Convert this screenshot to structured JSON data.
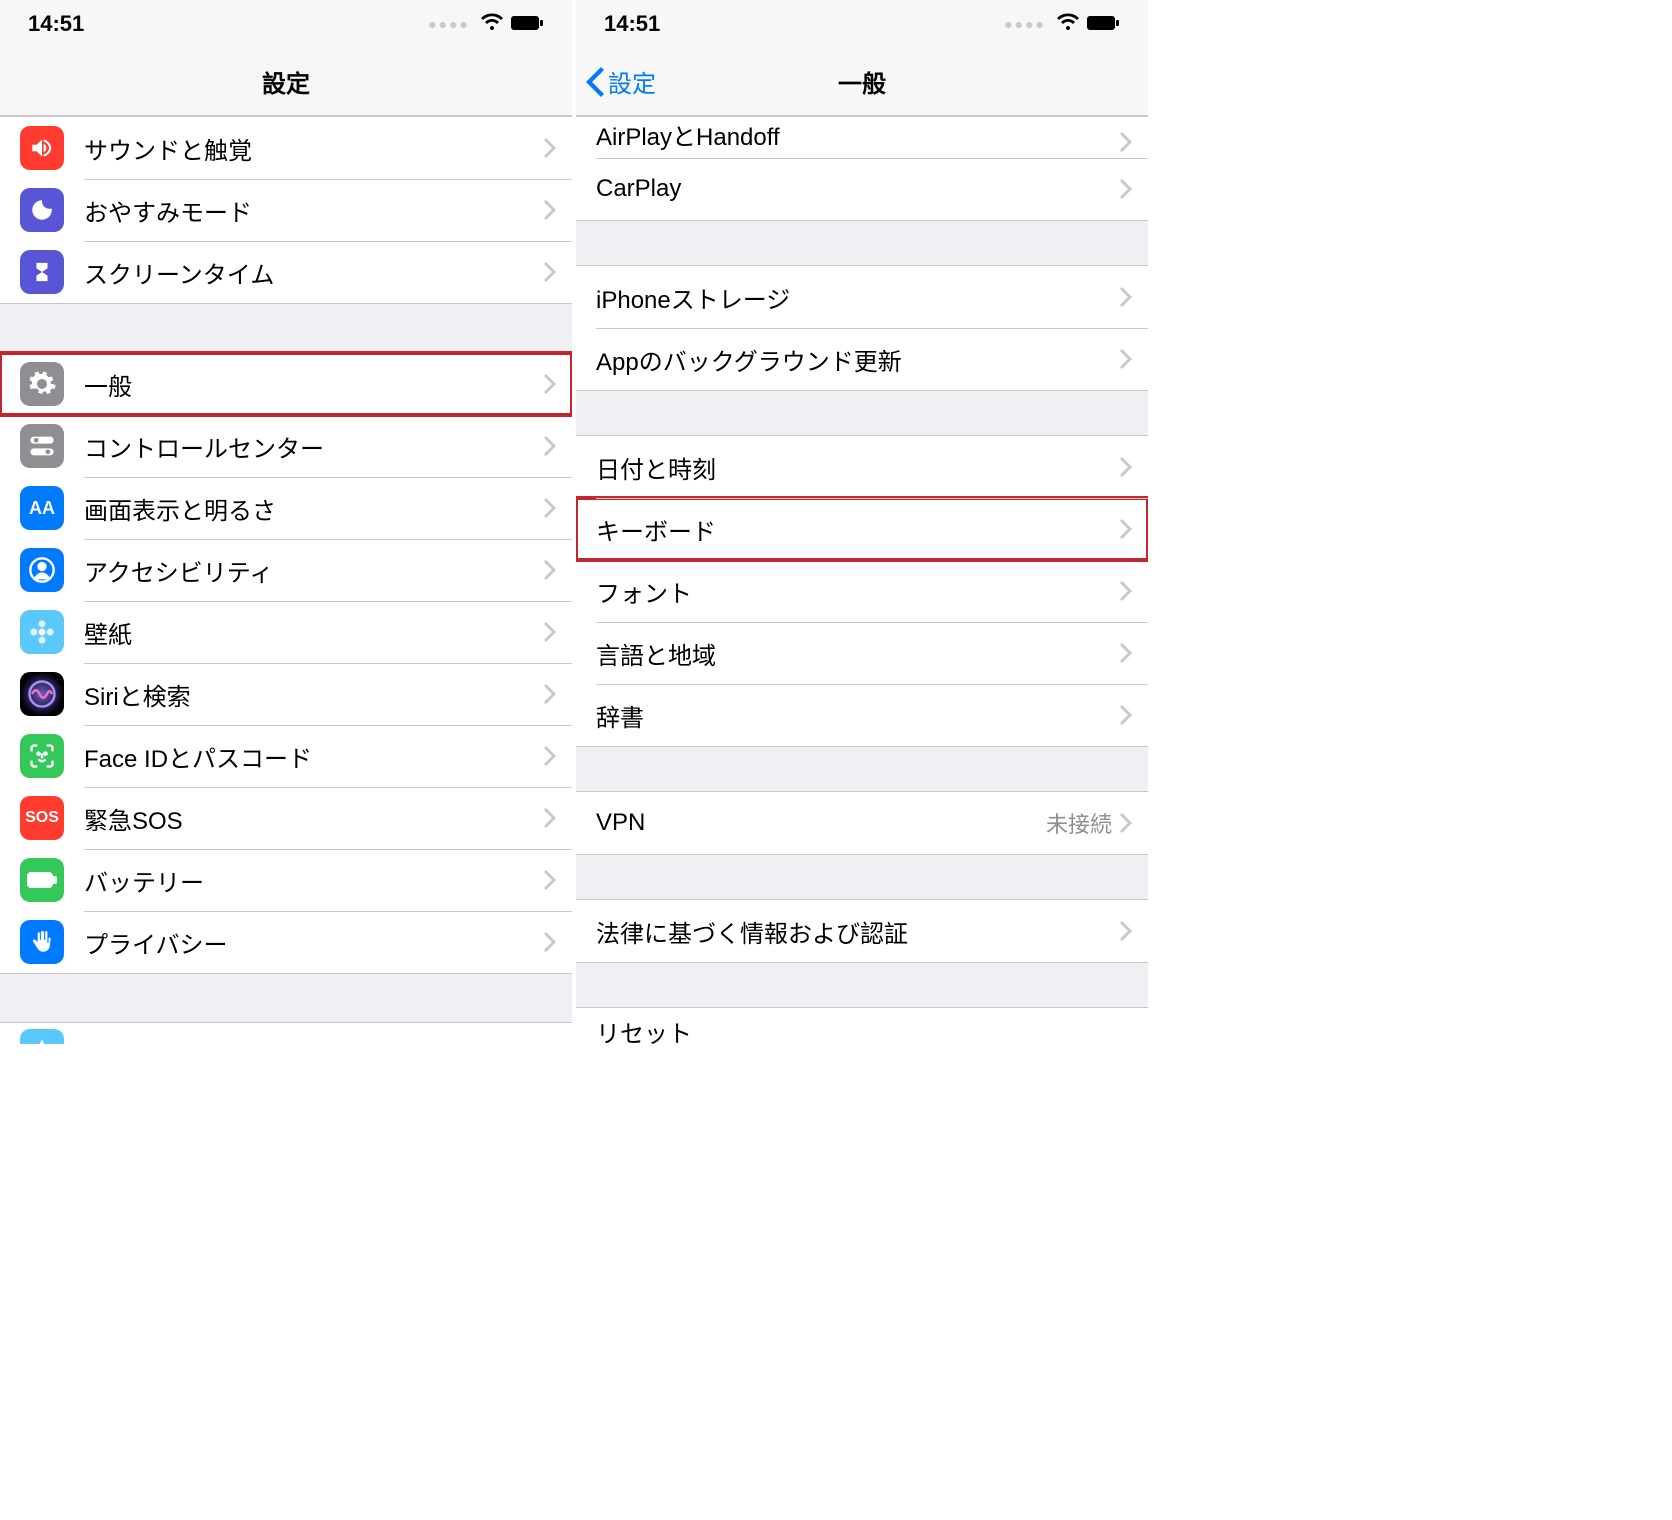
{
  "status": {
    "time": "14:51"
  },
  "left": {
    "title": "設定",
    "groups": [
      {
        "rows": [
          {
            "name": "sounds",
            "label": "サウンドと触覚",
            "icon": "speaker-icon",
            "bg": "bg-red"
          },
          {
            "name": "dnd",
            "label": "おやすみモード",
            "icon": "moon-icon",
            "bg": "bg-purple"
          },
          {
            "name": "screentime",
            "label": "スクリーンタイム",
            "icon": "hourglass-icon",
            "bg": "bg-purple2"
          }
        ]
      },
      {
        "rows": [
          {
            "name": "general",
            "label": "一般",
            "icon": "gear-icon",
            "bg": "bg-gray",
            "highlight": true
          },
          {
            "name": "control-center",
            "label": "コントロールセンター",
            "icon": "toggles-icon",
            "bg": "bg-gray2"
          },
          {
            "name": "display",
            "label": "画面表示と明るさ",
            "icon": "aa-icon",
            "bg": "bg-blue"
          },
          {
            "name": "accessibility",
            "label": "アクセシビリティ",
            "icon": "person-icon",
            "bg": "bg-blue"
          },
          {
            "name": "wallpaper",
            "label": "壁紙",
            "icon": "flower-icon",
            "bg": "bg-cyan"
          },
          {
            "name": "siri",
            "label": "Siriと検索",
            "icon": "siri-icon",
            "bg": "bg-siri"
          },
          {
            "name": "faceid",
            "label": "Face IDとパスコード",
            "icon": "faceid-icon",
            "bg": "bg-green"
          },
          {
            "name": "sos",
            "label": "緊急SOS",
            "icon": "sos-icon",
            "bg": "bg-sos"
          },
          {
            "name": "battery",
            "label": "バッテリー",
            "icon": "battery-icon",
            "bg": "bg-batt"
          },
          {
            "name": "privacy",
            "label": "プライバシー",
            "icon": "hand-icon",
            "bg": "bg-hand"
          }
        ]
      },
      {
        "partial": true,
        "rows": [
          {
            "name": "itunes",
            "label": "",
            "icon": "itunes-icon",
            "bg": "bg-itunes"
          }
        ]
      }
    ]
  },
  "right": {
    "back": "設定",
    "title": "一般",
    "topPartial": "AirPlayとHandoff",
    "groups": [
      {
        "topPartial": true,
        "rows": [
          {
            "name": "airplay",
            "label": "AirPlayとHandoff"
          },
          {
            "name": "carplay",
            "label": "CarPlay"
          }
        ]
      },
      {
        "rows": [
          {
            "name": "storage",
            "label": "iPhoneストレージ"
          },
          {
            "name": "bgrefresh",
            "label": "Appのバックグラウンド更新"
          }
        ]
      },
      {
        "rows": [
          {
            "name": "datetime",
            "label": "日付と時刻"
          },
          {
            "name": "keyboard",
            "label": "キーボード",
            "highlight": true
          },
          {
            "name": "fonts",
            "label": "フォント"
          },
          {
            "name": "language",
            "label": "言語と地域"
          },
          {
            "name": "dict",
            "label": "辞書"
          }
        ]
      },
      {
        "rows": [
          {
            "name": "vpn",
            "label": "VPN",
            "value": "未接続"
          }
        ]
      },
      {
        "rows": [
          {
            "name": "legal",
            "label": "法律に基づく情報および認証"
          }
        ]
      },
      {
        "partial": true,
        "rows": [
          {
            "name": "reset",
            "label": "リセット"
          }
        ]
      }
    ]
  }
}
